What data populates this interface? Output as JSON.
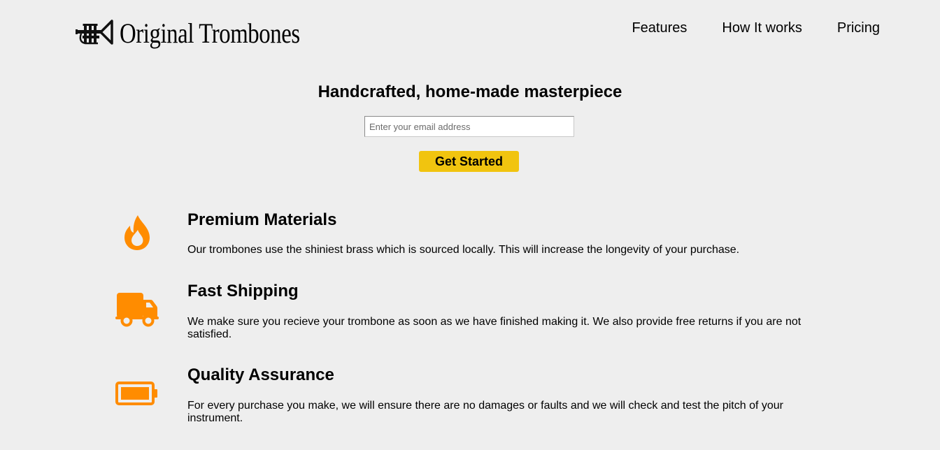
{
  "brand": {
    "name": "Original Trombones",
    "logo_icon": "trumpet-icon"
  },
  "nav": {
    "items": [
      {
        "label": "Features"
      },
      {
        "label": "How It works"
      },
      {
        "label": "Pricing"
      }
    ]
  },
  "hero": {
    "title": "Handcrafted, home-made masterpiece",
    "email_placeholder": "Enter your email address",
    "email_value": "",
    "cta_label": "Get Started"
  },
  "features": [
    {
      "icon": "fire-icon",
      "title": "Premium Materials",
      "description": "Our trombones use the shiniest brass which is sourced locally. This will increase the longevity of your purchase."
    },
    {
      "icon": "truck-icon",
      "title": "Fast Shipping",
      "description": "We make sure you recieve your trombone as soon as we have finished making it. We also provide free returns if you are not satisfied."
    },
    {
      "icon": "battery-full-icon",
      "title": "Quality Assurance",
      "description": "For every purchase you make, we will ensure there are no damages or faults and we will check and test the pitch of your instrument."
    }
  ],
  "colors": {
    "background": "#eeeeee",
    "accent_button": "#f1c40f",
    "icon_orange": "#ff8c00"
  }
}
